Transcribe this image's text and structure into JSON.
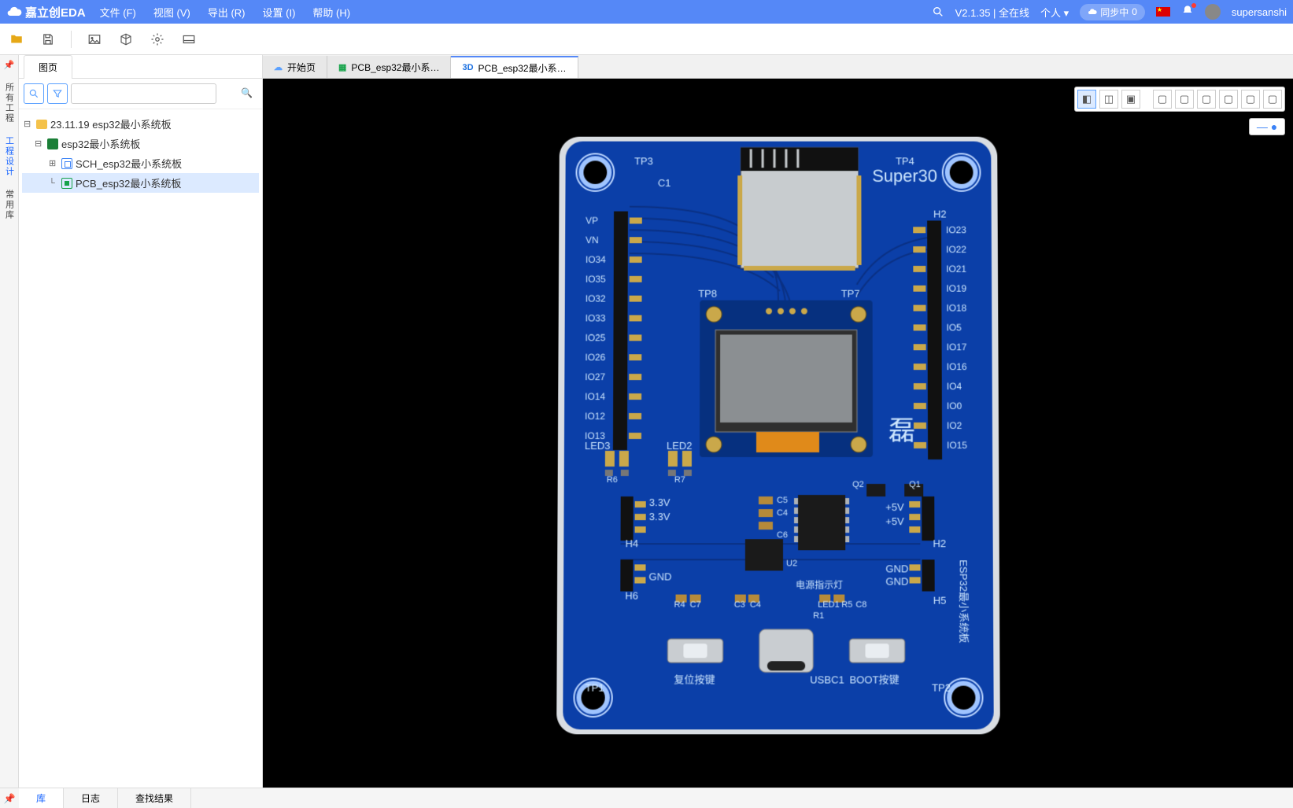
{
  "app": {
    "brand": "嘉立创EDA"
  },
  "menu": {
    "file": "文件 (F)",
    "view": "视图 (V)",
    "export": "导出 (R)",
    "settings": "设置 (I)",
    "help": "帮助 (H)"
  },
  "header": {
    "version_status": "V2.1.35 | 全在线",
    "account_type": "个人",
    "sync_label": "同步中",
    "sync_count": "0",
    "username": "supersanshi"
  },
  "sidebar": {
    "pages_tab": "图页",
    "rail": {
      "all_projects": "所有工程",
      "project_design": "工程设计",
      "common_lib": "常用库"
    },
    "search_placeholder": "",
    "tree": {
      "root": "23.11.19 esp32最小系统板",
      "project": "esp32最小系统板",
      "sch": "SCH_esp32最小系统板",
      "pcb": "PCB_esp32最小系统板"
    }
  },
  "tabs": {
    "start": "开始页",
    "pcb": "PCB_esp32最小系…",
    "threeD": "PCB_esp32最小系…",
    "threeD_prefix": "3D"
  },
  "bottom": {
    "lib": "库",
    "log": "日志",
    "results": "查找结果"
  },
  "board": {
    "brand": "Super30",
    "side_text": "ESP32最小系统板",
    "char": "磊",
    "btn_reset": "复位按键",
    "btn_boot": "BOOT按键",
    "usb": "USBC1",
    "pwr_led_label": "电源指示灯",
    "tp1": "TP1",
    "tp2": "TP2",
    "tp3": "TP3",
    "tp4": "TP4",
    "tp7": "TP7",
    "tp8": "TP8",
    "c1": "C1",
    "c3": "C3",
    "c4": "C4",
    "c5": "C5",
    "c6": "C6",
    "c7": "C7",
    "c8": "C8",
    "r1": "R1",
    "r4": "R4",
    "r6": "R6",
    "r7": "R7",
    "r5": "R5",
    "u2": "U2",
    "q1": "Q1",
    "q2": "Q2",
    "led1": "LED1",
    "led2": "LED2",
    "led3": "LED3",
    "h2": "H2",
    "h4": "H4",
    "h5": "H5",
    "h6": "H6",
    "v33a": "3.3V",
    "v33b": "3.3V",
    "p5va": "+5V",
    "p5vb": "+5V",
    "gnd": "GND",
    "left_pins": [
      "VP",
      "VN",
      "IO34",
      "IO35",
      "IO32",
      "IO33",
      "IO25",
      "IO26",
      "IO27",
      "IO14",
      "IO12",
      "IO13"
    ],
    "right_pins": [
      "IO23",
      "IO22",
      "IO21",
      "IO19",
      "IO18",
      "IO5",
      "IO17",
      "IO16",
      "IO4",
      "IO0",
      "IO2",
      "IO15"
    ]
  }
}
